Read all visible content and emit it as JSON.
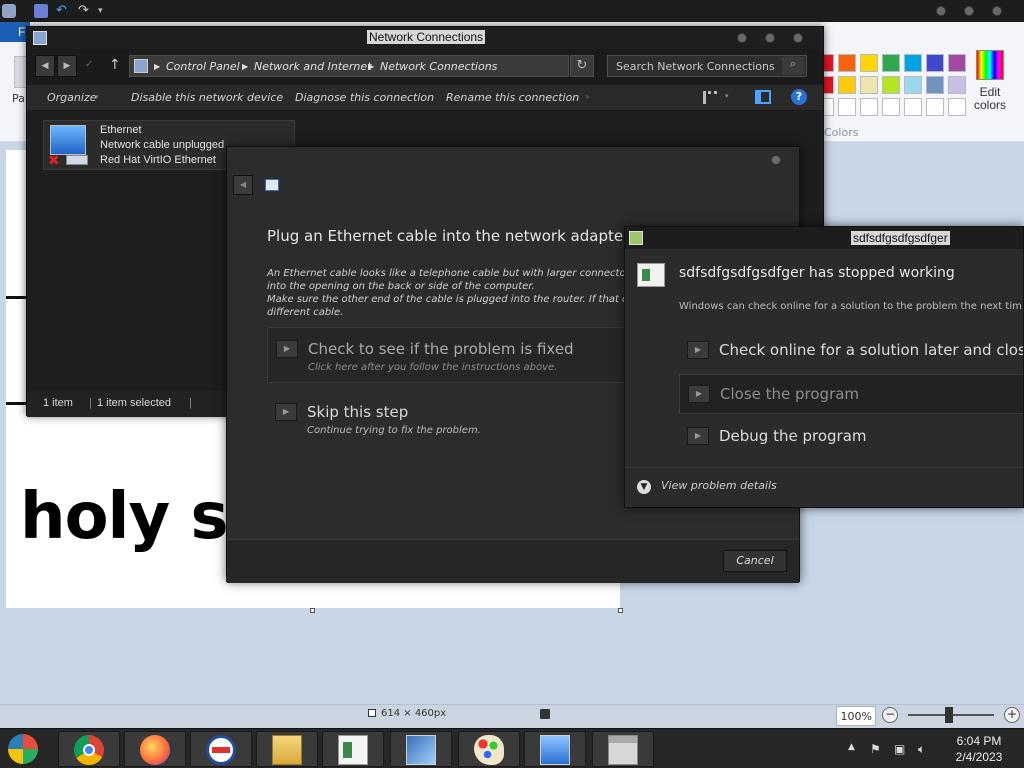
{
  "paint": {
    "file_tab": "Fi",
    "pa_label": "Pa",
    "edit_colors": "Edit colors",
    "colors_label": "Colors",
    "canvas_text": "holy sh",
    "canvas_size": "614 × 460px",
    "zoom": "100%",
    "swatch_colors": [
      "#e81123",
      "#f7630c",
      "#ffd700",
      "#2fa84f",
      "#00a3e0",
      "#3f48cc",
      "#a349a4",
      "#e81123",
      "#ffc90e",
      "#efe4b0",
      "#b5e61d",
      "#99d9ea",
      "#7092be",
      "#c8bfe7"
    ]
  },
  "network_window": {
    "title": "Network Connections",
    "breadcrumb": [
      "Control Panel",
      "Network and Internet",
      "Network Connections"
    ],
    "search_placeholder": "Search Network Connections",
    "commands": [
      "Organize",
      "Disable this network device",
      "Diagnose this connection",
      "Rename this connection"
    ],
    "adapter": {
      "name": "Ethernet",
      "status": "Network cable unplugged",
      "device": "Red Hat VirtIO Ethernet"
    },
    "status_count": "1 item",
    "status_selected": "1 item selected"
  },
  "troubleshooter": {
    "heading": "Plug an Ethernet cable into the network adapter",
    "description": [
      "An Ethernet cable looks like a telephone cable but with larger connectors",
      "into the opening on the back or side of the computer.",
      "Make sure the other end of the cable is plugged into the router. If that do",
      "different cable."
    ],
    "option1_title": "Check to see if the problem is fixed",
    "option1_sub": "Click here after you follow the instructions above.",
    "option2_title": "Skip this step",
    "option2_sub": "Continue trying to fix the problem.",
    "cancel": "Cancel"
  },
  "crash_dialog": {
    "title": "sdfsdfgsdfgsdfger",
    "heading": "sdfsdfgsdfgsdfger has stopped working",
    "subtext": "Windows can check online for a solution to the problem the next tim",
    "option_online": "Check online for a solution later and close",
    "option_close": "Close the program",
    "option_debug": "Debug the program",
    "details": "View problem details"
  },
  "taskbar": {
    "time": "6:04 PM",
    "date": "2/4/2023",
    "apps": [
      "start-orb",
      "chrome",
      "firefox",
      "opera",
      "file-explorer",
      "notepad",
      "troubleshooter",
      "paint",
      "network",
      "archive"
    ]
  }
}
